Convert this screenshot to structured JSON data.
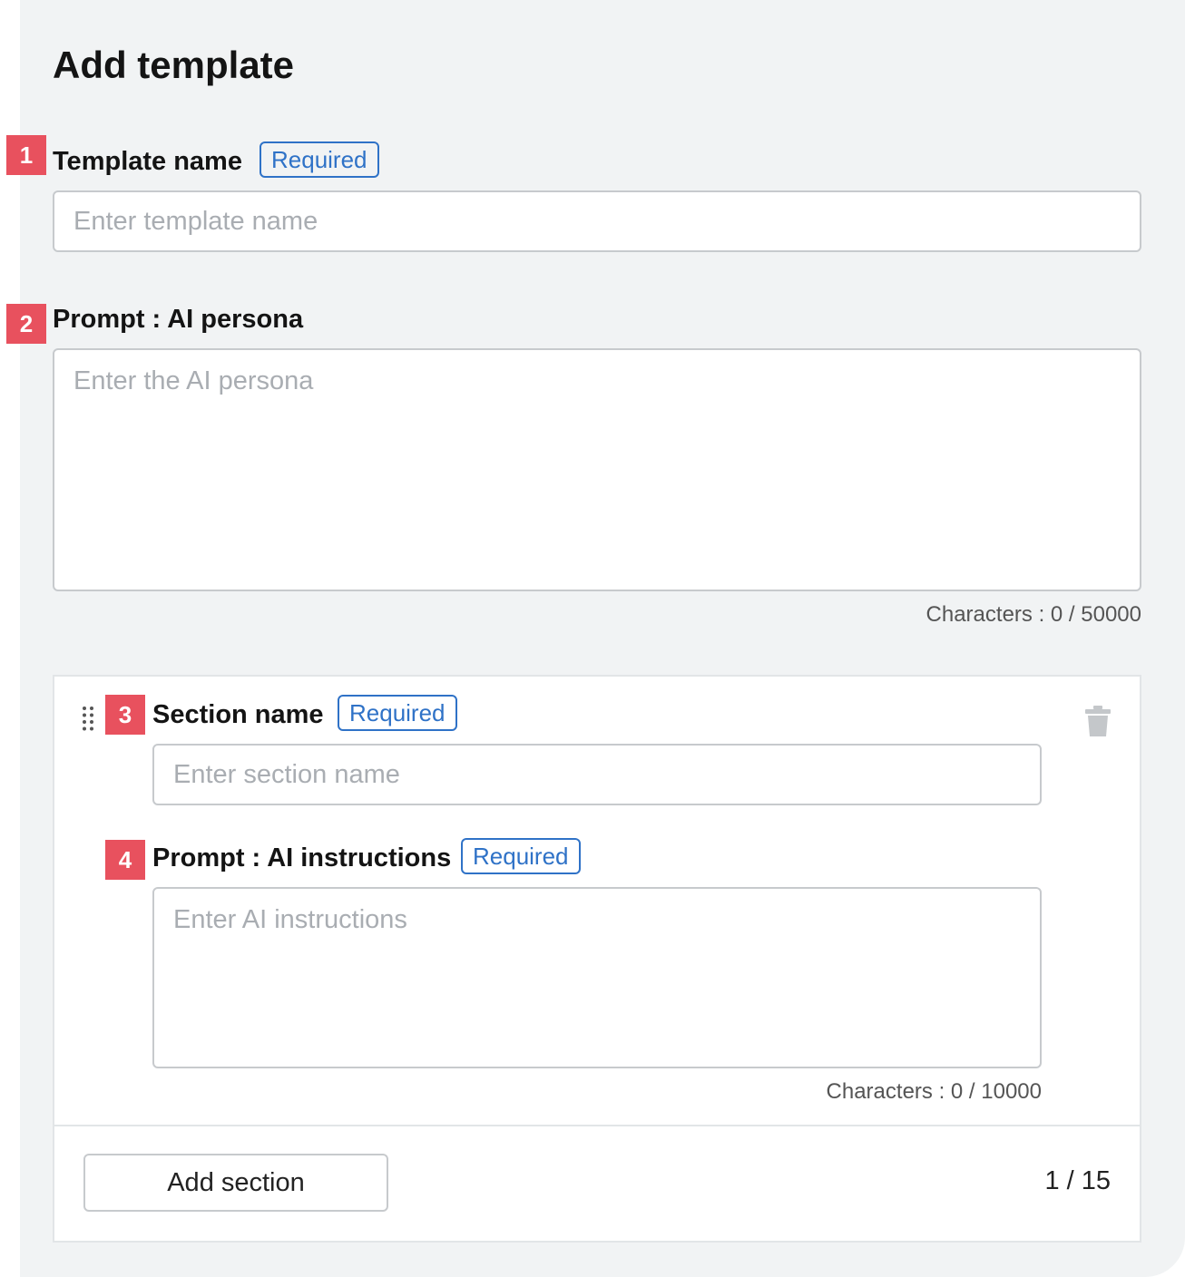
{
  "page": {
    "title": "Add template"
  },
  "markers": [
    "1",
    "2",
    "3",
    "4"
  ],
  "template_name": {
    "label": "Template name",
    "badge": "Required",
    "placeholder": "Enter template name",
    "value": ""
  },
  "ai_persona": {
    "label": "Prompt : AI persona",
    "placeholder": "Enter the AI persona",
    "value": "",
    "counter": "Characters : 0 / 50000"
  },
  "section": {
    "name_label": "Section name",
    "name_badge": "Required",
    "name_placeholder": "Enter section name",
    "name_value": "",
    "instructions_label": "Prompt : AI instructions",
    "instructions_badge": "Required",
    "instructions_placeholder": "Enter AI instructions",
    "instructions_value": "",
    "counter": "Characters : 0 / 10000",
    "icons": {
      "drag": "drag-handle-icon",
      "delete": "trash-icon"
    }
  },
  "footer": {
    "add_section_label": "Add section",
    "count": "1 / 15"
  },
  "colors": {
    "marker": "#e8515e",
    "badge": "#2f72c7",
    "panel": "#f1f3f4"
  }
}
